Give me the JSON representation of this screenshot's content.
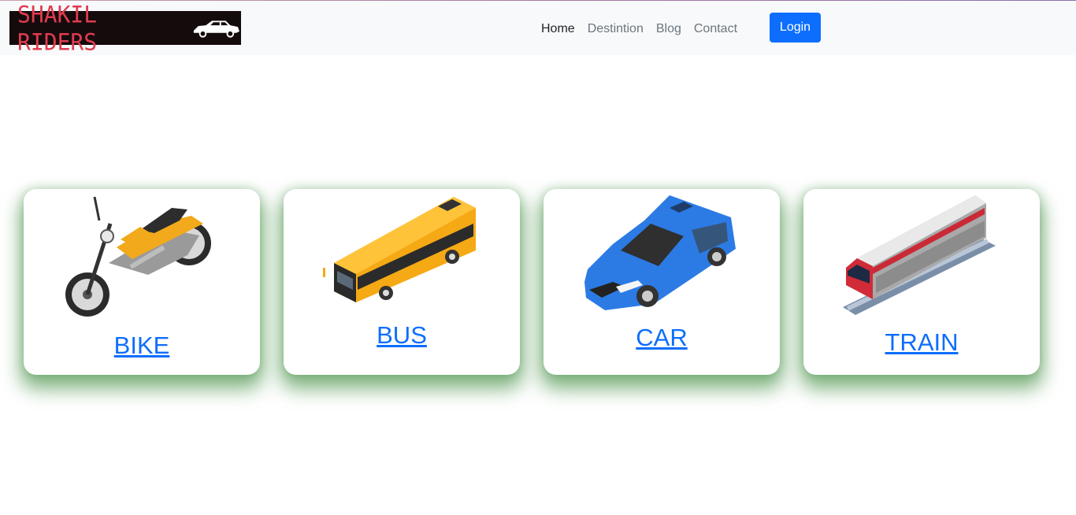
{
  "brand": {
    "name": "SHAKIL RIDERS",
    "logo_icon": "car-icon"
  },
  "nav": {
    "items": [
      {
        "label": "Home",
        "active": true
      },
      {
        "label": "Destintion",
        "active": false
      },
      {
        "label": "Blog",
        "active": false
      },
      {
        "label": "Contact",
        "active": false
      }
    ],
    "login_label": "Login"
  },
  "cards": [
    {
      "label": "BIKE",
      "icon": "motorcycle-icon"
    },
    {
      "label": "BUS",
      "icon": "bus-icon"
    },
    {
      "label": "CAR",
      "icon": "car-icon"
    },
    {
      "label": "TRAIN",
      "icon": "train-icon"
    }
  ],
  "colors": {
    "accent": "#0d6efd",
    "shadow": "#2e7d32",
    "logo_text": "#e23b4e"
  }
}
